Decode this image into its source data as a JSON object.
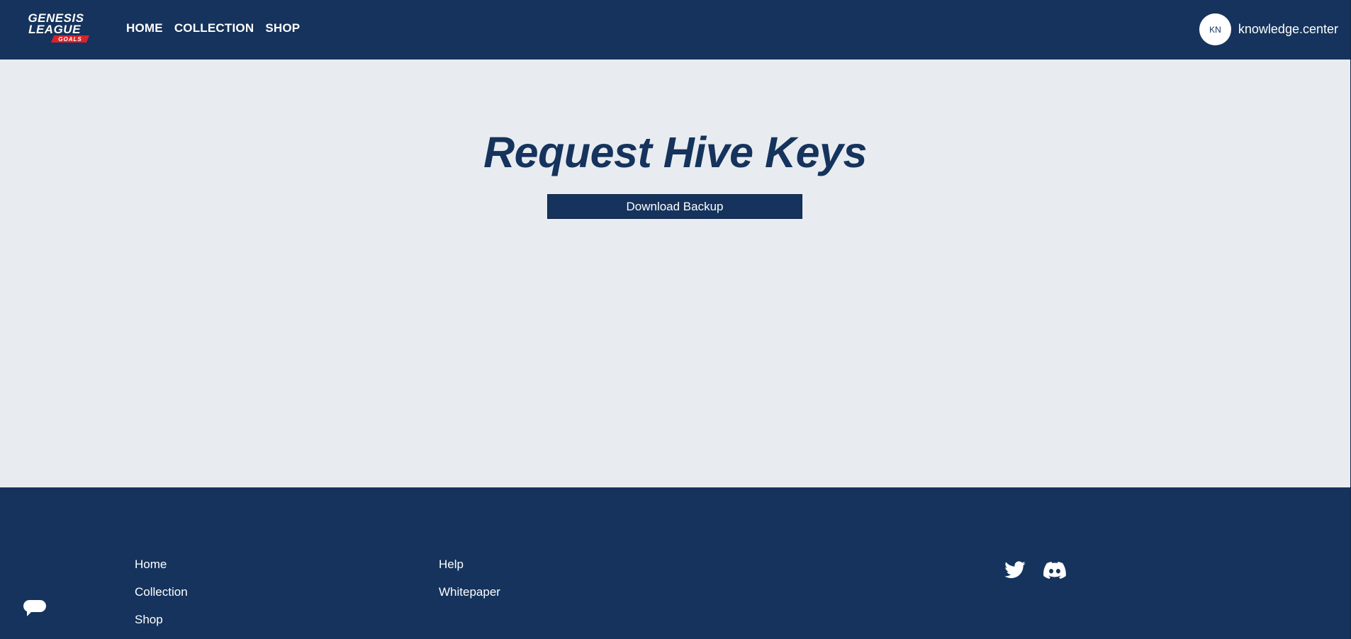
{
  "header": {
    "logo": {
      "line1": "GENESIS",
      "line2": "LEAGUE",
      "line3": "GOALS",
      "icon": "genesis-league-goals-logo"
    },
    "nav": [
      {
        "label": "HOME"
      },
      {
        "label": "COLLECTION"
      },
      {
        "label": "SHOP"
      }
    ],
    "user": {
      "initials": "KN",
      "username": "knowledge.center"
    }
  },
  "main": {
    "title": "Request Hive Keys",
    "download_button": "Download Backup"
  },
  "footer": {
    "col1": [
      {
        "label": "Home"
      },
      {
        "label": "Collection"
      },
      {
        "label": "Shop"
      }
    ],
    "col2": [
      {
        "label": "Help"
      },
      {
        "label": "Whitepaper"
      }
    ],
    "socials": [
      {
        "icon": "twitter-icon"
      },
      {
        "icon": "discord-icon"
      }
    ]
  },
  "chat_widget": {
    "icon": "chat-icon"
  },
  "colors": {
    "navy": "#15335c",
    "background": "#e8ecf0",
    "logo_red": "#d8232a",
    "white": "#ffffff"
  }
}
